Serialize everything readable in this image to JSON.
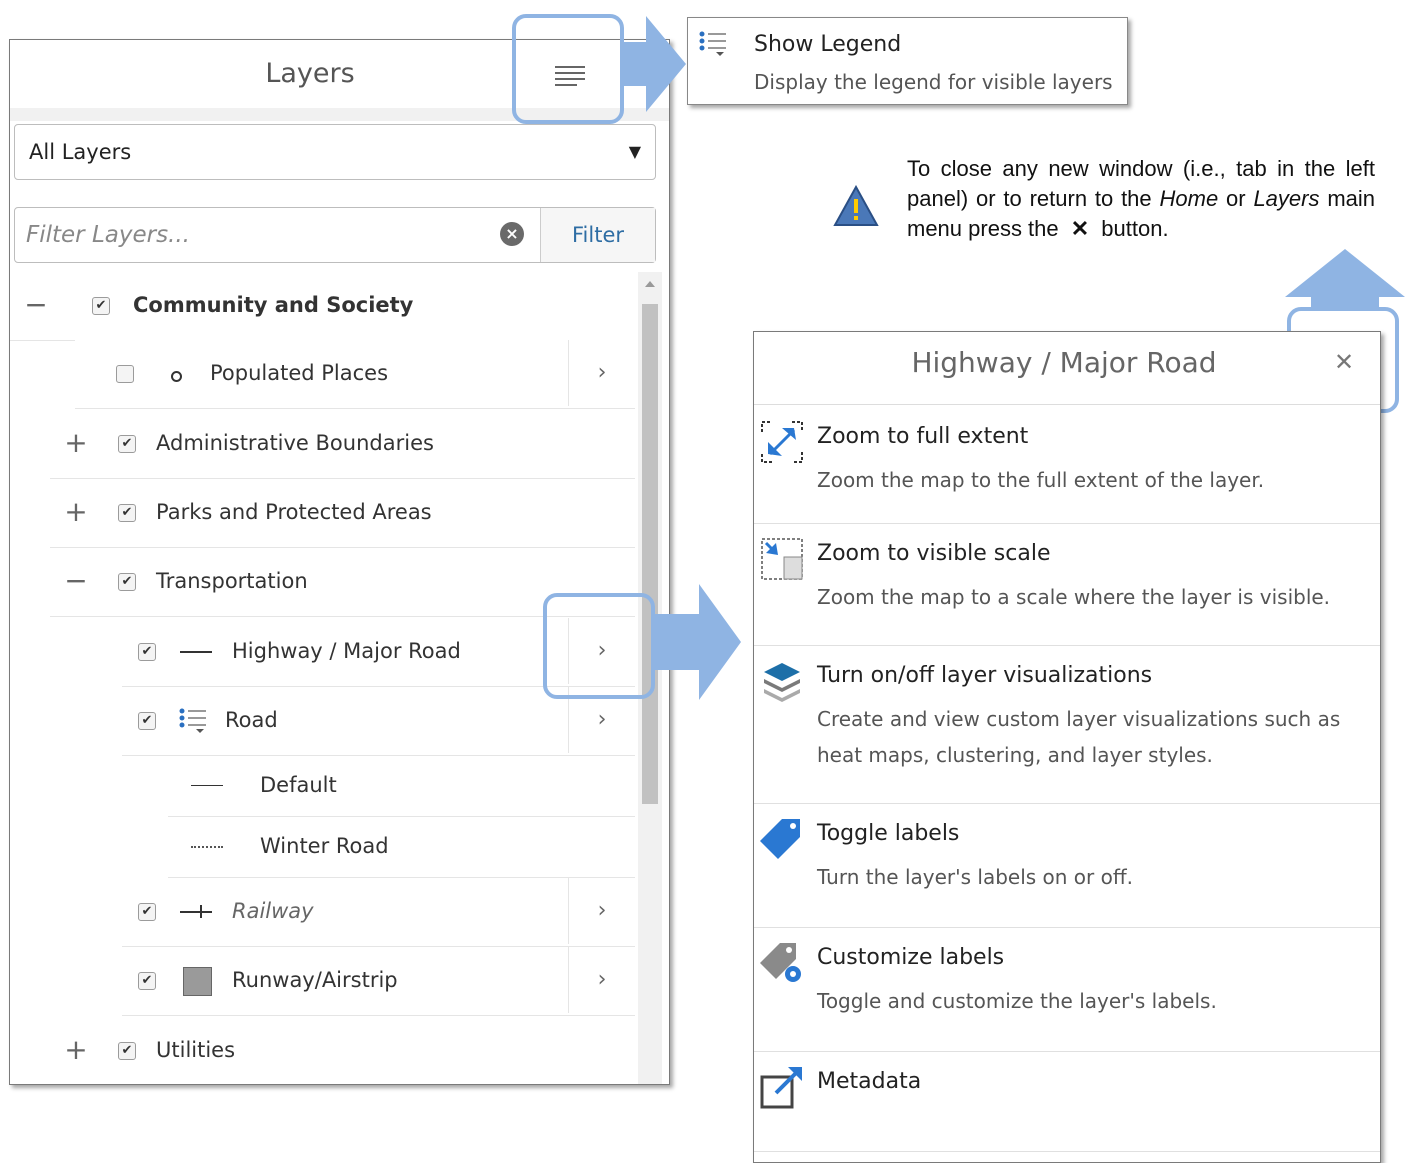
{
  "layers_panel": {
    "title": "Layers",
    "dropdown_value": "All Layers",
    "filter_placeholder": "Filter Layers...",
    "filter_button": "Filter",
    "tree": [
      {
        "label": "Community and Society",
        "checked": true,
        "expander": "−",
        "chevron": false,
        "bold": true
      },
      {
        "label": "Populated Places",
        "checked": false,
        "symbol": "point",
        "chevron": true
      },
      {
        "label": "Administrative Boundaries",
        "checked": true,
        "expander": "+",
        "chevron": false
      },
      {
        "label": "Parks and Protected Areas",
        "checked": true,
        "expander": "+",
        "chevron": false
      },
      {
        "label": "Transportation",
        "checked": true,
        "expander": "−",
        "chevron": false
      },
      {
        "label": "Highway / Major Road",
        "checked": true,
        "symbol": "line",
        "chevron": true
      },
      {
        "label": "Road",
        "checked": true,
        "symbol": "legend-list",
        "chevron": true
      },
      {
        "label": "Default",
        "symbol": "line"
      },
      {
        "label": "Winter Road",
        "symbol": "dotted-line"
      },
      {
        "label": "Railway",
        "checked": true,
        "symbol": "railway",
        "chevron": true,
        "italic": true
      },
      {
        "label": "Runway/Airstrip",
        "checked": true,
        "symbol": "square",
        "chevron": true
      },
      {
        "label": "Utilities",
        "checked": true,
        "expander": "+",
        "chevron": false
      }
    ]
  },
  "legend_popup": {
    "title": "Show Legend",
    "description": "Display the legend for visible layers"
  },
  "note": {
    "part1": "To close any new window (i.e., tab in the left panel) or to return to the ",
    "home": "Home",
    "part2": " or ",
    "layers": "Layers",
    "part3": " main menu press the ",
    "close_glyph": "✕",
    "part4": " button."
  },
  "options_panel": {
    "title": "Highway / Major Road",
    "close_glyph": "✕",
    "options": [
      {
        "icon": "zoom-full-extent-icon",
        "title": "Zoom to full extent",
        "description": "Zoom the map to the full extent of the layer."
      },
      {
        "icon": "zoom-visible-scale-icon",
        "title": "Zoom to visible scale",
        "description": "Zoom the map to a scale where the layer is visible."
      },
      {
        "icon": "layers-stack-icon",
        "title": "Turn on/off layer visualizations",
        "description": "Create and view custom layer visualizations such as heat maps, clustering, and layer styles."
      },
      {
        "icon": "tag-icon",
        "title": "Toggle labels",
        "description": "Turn the layer's labels on or off."
      },
      {
        "icon": "tag-gear-icon",
        "title": "Customize labels",
        "description": "Toggle and customize the layer's labels."
      },
      {
        "icon": "external-link-icon",
        "title": "Metadata",
        "description": ""
      }
    ]
  },
  "colors": {
    "accent_blue": "#8fb4e3",
    "link_blue": "#2e6da4"
  }
}
